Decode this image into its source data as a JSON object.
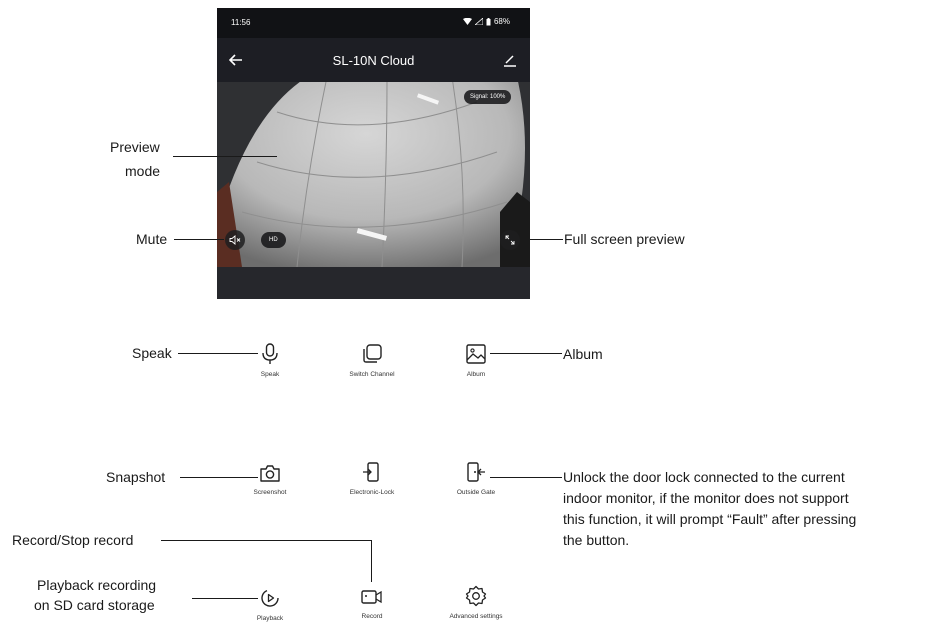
{
  "status_bar": {
    "time": "11:56",
    "battery": "68%"
  },
  "app_bar": {
    "title": "SL-10N Cloud",
    "back_icon": "arrow-left-icon",
    "edit_icon": "pencil-icon"
  },
  "video": {
    "signal_label": "Signal: 100%",
    "quality_label": "HD",
    "mute_icon": "speaker-muted-icon",
    "fullscreen_icon": "expand-icon"
  },
  "controls": [
    {
      "label": "Speak",
      "icon": "microphone-icon"
    },
    {
      "label": "Switch Channel",
      "icon": "switch-channel-icon"
    },
    {
      "label": "Album",
      "icon": "image-icon"
    },
    {
      "label": "Screenshot",
      "icon": "camera-icon"
    },
    {
      "label": "Electronic-Lock",
      "icon": "lock-door-icon"
    },
    {
      "label": "Outside Gate",
      "icon": "gate-icon"
    },
    {
      "label": "Playback",
      "icon": "playback-icon"
    },
    {
      "label": "Record",
      "icon": "video-camera-icon"
    },
    {
      "label": "Advanced settings",
      "icon": "gear-icon"
    }
  ],
  "annotations": {
    "preview_mode_1": "Preview",
    "preview_mode_2": "mode",
    "mute": "Mute",
    "full_screen": "Full screen preview",
    "speak": "Speak",
    "album": "Album",
    "snapshot": "Snapshot",
    "unlock_1": "Unlock the door lock connected to the current",
    "unlock_2": "indoor monitor, if the monitor does not support",
    "unlock_3": "this function, it will prompt “Fault” after pressing",
    "unlock_4": "the button.",
    "record": "Record/Stop record",
    "playback_1": "Playback recording",
    "playback_2": "on SD card storage"
  }
}
